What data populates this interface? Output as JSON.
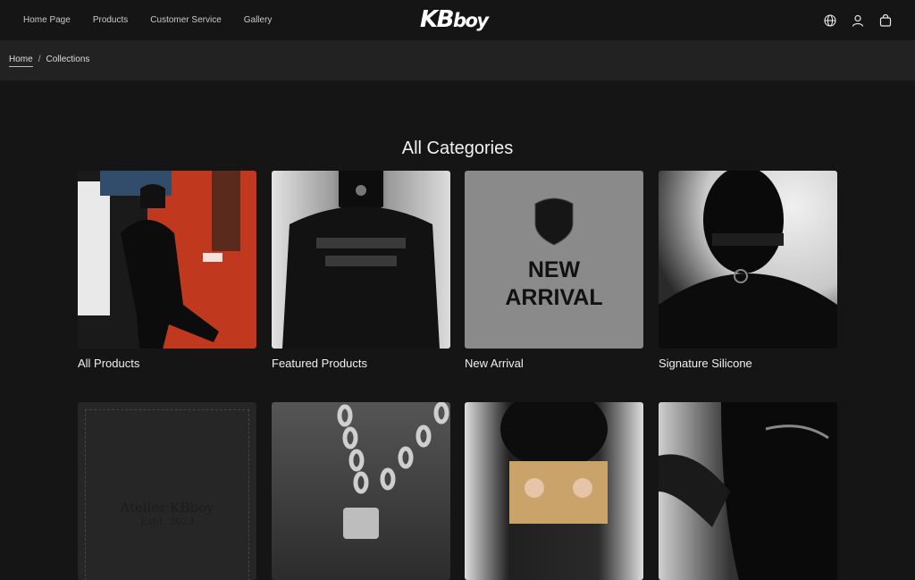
{
  "nav": {
    "items": [
      "Home Page",
      "Products",
      "Customer Service",
      "Gallery"
    ],
    "logo_main": "KB",
    "logo_tail": "boy"
  },
  "breadcrumb": {
    "home": "Home",
    "separator": "/",
    "current": "Collections"
  },
  "page": {
    "title": "All Categories"
  },
  "categories": [
    {
      "label": "All Products"
    },
    {
      "label": "Featured Products"
    },
    {
      "label": "New Arrival",
      "tile_text_1": "NEW",
      "tile_text_2": "ARRIVAL"
    },
    {
      "label": "Signature Silicone"
    },
    {
      "label": "",
      "tile_text_1": "Atelier KBboy",
      "tile_text_2": "Estd. 2023"
    },
    {
      "label": ""
    },
    {
      "label": ""
    },
    {
      "label": ""
    }
  ],
  "icons": [
    "globe-icon",
    "account-icon",
    "bag-icon"
  ],
  "colors": {
    "background": "#151515",
    "breadcrumb_bar": "#222222",
    "text": "#ffffff"
  }
}
